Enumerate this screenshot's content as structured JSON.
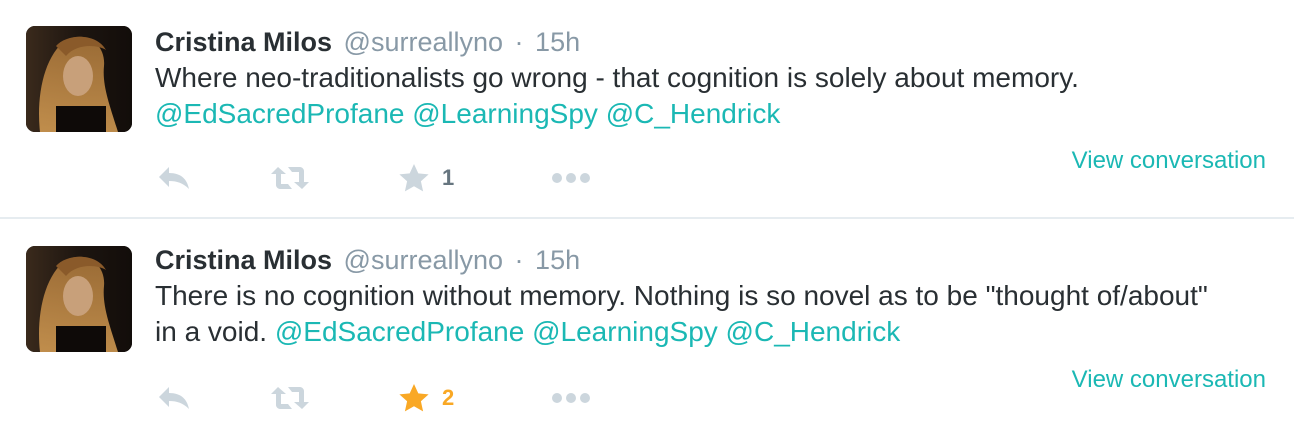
{
  "tweets": [
    {
      "name": "Cristina Milos",
      "handle": "@surreallyno",
      "separator": "·",
      "time": "15h",
      "text": "Where neo-traditionalists go wrong - that cognition is solely about memory.",
      "mentions": [
        "@EdSacredProfane",
        "@LearningSpy",
        "@C_Hendrick"
      ],
      "favorite_count": "1",
      "favorited": false,
      "view_conversation": "View conversation"
    },
    {
      "name": "Cristina Milos",
      "handle": "@surreallyno",
      "separator": "·",
      "time": "15h",
      "text": "There is no cognition without memory. Nothing is so novel as to be \"thought of/about\" in a void.",
      "mentions": [
        "@EdSacredProfane",
        "@LearningSpy",
        "@C_Hendrick"
      ],
      "favorite_count": "2",
      "favorited": true,
      "view_conversation": "View conversation"
    }
  ],
  "icons": {
    "reply": "reply-icon",
    "retweet": "retweet-icon",
    "favorite": "star-icon",
    "more": "more-dots-icon"
  },
  "colors": {
    "mention": "#1bb8b4",
    "icon_gray": "#ccd6dd",
    "favorited": "#f9a825",
    "name": "#292f33",
    "meta": "#8899a6"
  }
}
